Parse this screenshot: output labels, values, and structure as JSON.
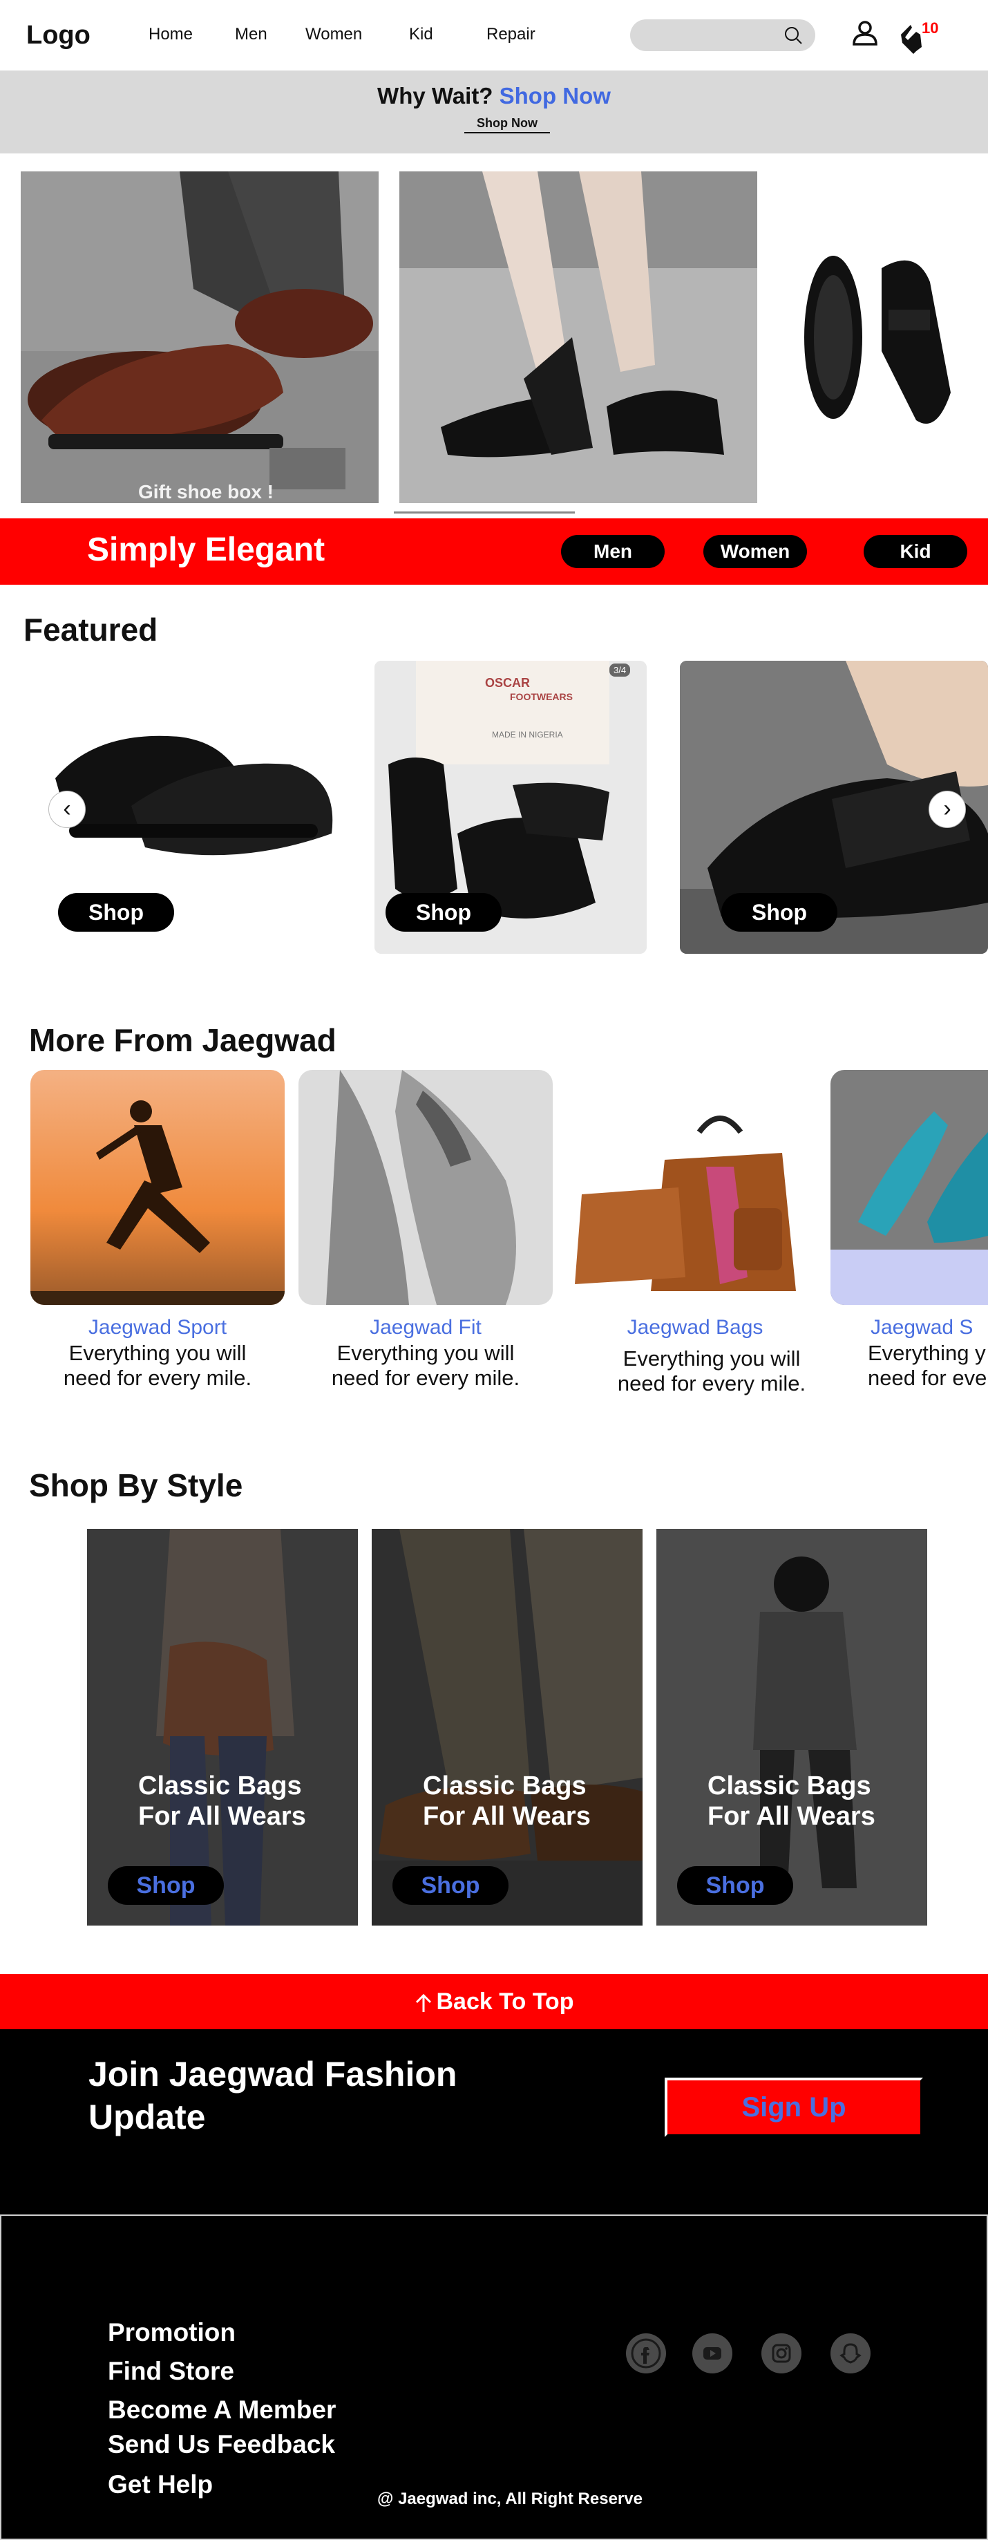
{
  "header": {
    "logo": "Logo",
    "nav": [
      "Home",
      "Men",
      "Women",
      "Kid",
      "Repair"
    ],
    "search_placeholder": "",
    "cart_count": "10"
  },
  "promo": {
    "question": "Why Wait?",
    "link": "Shop Now",
    "button": "Shop Now"
  },
  "hero": {
    "caption": "Gift shoe box !"
  },
  "strip": {
    "title": "Simply Elegant",
    "pills": [
      "Men",
      "Women",
      "Kid"
    ]
  },
  "featured": {
    "title": "Featured",
    "cards": [
      {
        "shop": "Shop"
      },
      {
        "shop": "Shop"
      },
      {
        "shop": "Shop"
      }
    ],
    "prev_symbol": "‹",
    "next_symbol": "›",
    "counter": "3/4",
    "box_text_1": "OSCAR",
    "box_text_2": "FOOTWEARS",
    "box_text_3": "MADE IN NIGERIA"
  },
  "more": {
    "title": "More From Jaegwad",
    "cards": [
      {
        "title": "Jaegwad Sport",
        "desc_1": "Everything you will",
        "desc_2": "need for every mile."
      },
      {
        "title": "Jaegwad  Fit",
        "desc_1": "Everything you will",
        "desc_2": "need for every mile."
      },
      {
        "title": "Jaegwad  Bags",
        "desc_1": "Everything you will",
        "desc_2": "need for every mile."
      },
      {
        "title": "Jaegwad S",
        "desc_1": "Everything y",
        "desc_2": "need for eve"
      }
    ]
  },
  "style": {
    "title": "Shop By Style",
    "cards": [
      {
        "line1": "Classic Bags",
        "line2": "For All Wears",
        "shop": "Shop"
      },
      {
        "line1": "Classic Bags",
        "line2": "For All Wears",
        "shop": "Shop"
      },
      {
        "line1": "Classic Bags",
        "line2": "For All Wears",
        "shop": "Shop"
      }
    ]
  },
  "back_to_top": "Back To Top",
  "newsletter": {
    "title": "Join Jaegwad Fashion Update",
    "signup": "Sign Up"
  },
  "footer": {
    "links": [
      "Promotion",
      "Find Store",
      "Become  A Member",
      "Send Us Feedback",
      "Get Help"
    ],
    "copyright": "@ Jaegwad inc, All  Right Reserve",
    "social_icons": [
      "facebook-icon",
      "youtube-icon",
      "instagram-icon",
      "snapchat-icon"
    ]
  },
  "colors": {
    "accent_red": "#ff0000",
    "link_blue": "#4a6fe0",
    "banner_gray": "#d9d9d9"
  }
}
